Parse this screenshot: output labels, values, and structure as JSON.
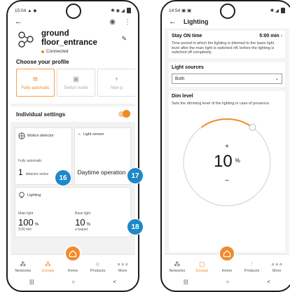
{
  "left": {
    "status_time": "15:04",
    "status_icons_left": "▲ ◆",
    "status_icons_right": "✱ ◉ ◢",
    "back": "←",
    "device": {
      "name_line1": "ground",
      "name_line2": "floor_entrance",
      "status": "Connected"
    },
    "profile_title": "Choose your profile",
    "profiles": [
      {
        "label": "Fully automatic",
        "icon": "≋"
      },
      {
        "label": "Switch mode",
        "icon": "▣"
      },
      {
        "label": "New p",
        "icon": "+"
      }
    ],
    "individual_settings": "Individual settings",
    "tiles": {
      "motion": {
        "title": "Motion detector",
        "mode": "Fully automatic",
        "count": "1",
        "count_label": "detector active"
      },
      "light_sensor": {
        "title": "Light sensor",
        "value": "Daytime operation"
      },
      "lighting": {
        "title": "Lighting",
        "main_label": "Main light",
        "main_value": "100",
        "main_unit": "%",
        "main_sub": "3:00 min",
        "base_label": "Base light",
        "base_value": "10",
        "base_unit": "%",
        "base_sub": "e based"
      }
    },
    "nav": [
      {
        "label": "Networks"
      },
      {
        "label": "Groups"
      },
      {
        "label": "Home"
      },
      {
        "label": "Products"
      },
      {
        "label": "More"
      }
    ],
    "sys": [
      "|||",
      "○",
      "<"
    ]
  },
  "right": {
    "status_time": "14:54",
    "status_icons_left": "▣ ▣",
    "status_icons_right": "✱ ◢",
    "back": "←",
    "title": "Lighting",
    "stay_on": {
      "title": "Stay ON time",
      "value": "5:00 min",
      "description": "Time period in which the lighting is dimmed to the basic light level after the main light is switched off, before the lighting is switched off completely."
    },
    "light_sources": {
      "title": "Light sources",
      "selected": "Both"
    },
    "dim": {
      "title": "Dim level",
      "description": "Sets the dimming level of the lighting in case of presence.",
      "plus": "+",
      "value": "10",
      "unit": "%",
      "minus": "–",
      "level": 0.1
    },
    "nav": [
      {
        "label": "Networks"
      },
      {
        "label": "Groups"
      },
      {
        "label": "Home"
      },
      {
        "label": "Products"
      },
      {
        "label": "More"
      }
    ],
    "sys": [
      "|||",
      "○",
      "<"
    ]
  },
  "badges": [
    "16",
    "17",
    "18"
  ],
  "colors": {
    "accent": "#f08a24",
    "badge": "#1e88c9"
  }
}
